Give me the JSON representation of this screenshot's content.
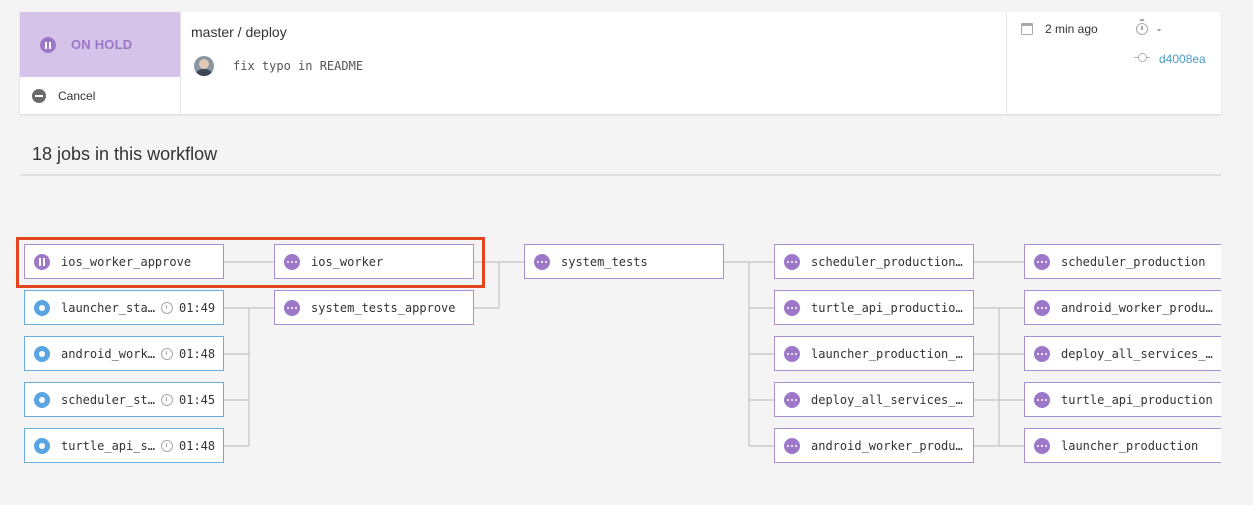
{
  "header": {
    "status_label": "ON HOLD",
    "cancel_label": "Cancel",
    "branch": "master / deploy",
    "commit_message": "fix typo in README",
    "time_ago": "2 min ago",
    "duration": "-",
    "sha": "d4008ea"
  },
  "jobs_title": "18 jobs in this workflow",
  "colors": {
    "on_hold": "#d5c3e9",
    "purple": "#9d78c8",
    "blue": "#5ba4e2",
    "highlight": "#e2451f",
    "link": "#4a9cc9"
  },
  "jobs": [
    {
      "name": "ios_worker_approve",
      "status": "on-hold",
      "time": ""
    },
    {
      "name": "ios_worker",
      "status": "queued",
      "time": ""
    },
    {
      "name": "launcher_sta…",
      "status": "running",
      "time": "01:49"
    },
    {
      "name": "system_tests_approve",
      "status": "queued",
      "time": ""
    },
    {
      "name": "android_work…",
      "status": "running",
      "time": "01:48"
    },
    {
      "name": "scheduler_st…",
      "status": "running",
      "time": "01:45"
    },
    {
      "name": "turtle_api_s…",
      "status": "running",
      "time": "01:48"
    },
    {
      "name": "system_tests",
      "status": "queued",
      "time": ""
    },
    {
      "name": "scheduler_production…",
      "status": "queued",
      "time": ""
    },
    {
      "name": "turtle_api_productio…",
      "status": "queued",
      "time": ""
    },
    {
      "name": "launcher_production_…",
      "status": "queued",
      "time": ""
    },
    {
      "name": "deploy_all_services_…",
      "status": "queued",
      "time": ""
    },
    {
      "name": "android_worker_produ…",
      "status": "queued",
      "time": ""
    },
    {
      "name": "scheduler_production",
      "status": "queued",
      "time": ""
    },
    {
      "name": "android_worker_produ…",
      "status": "queued",
      "time": ""
    },
    {
      "name": "deploy_all_services_…",
      "status": "queued",
      "time": ""
    },
    {
      "name": "turtle_api_production",
      "status": "queued",
      "time": ""
    },
    {
      "name": "launcher_production",
      "status": "queued",
      "time": ""
    }
  ]
}
